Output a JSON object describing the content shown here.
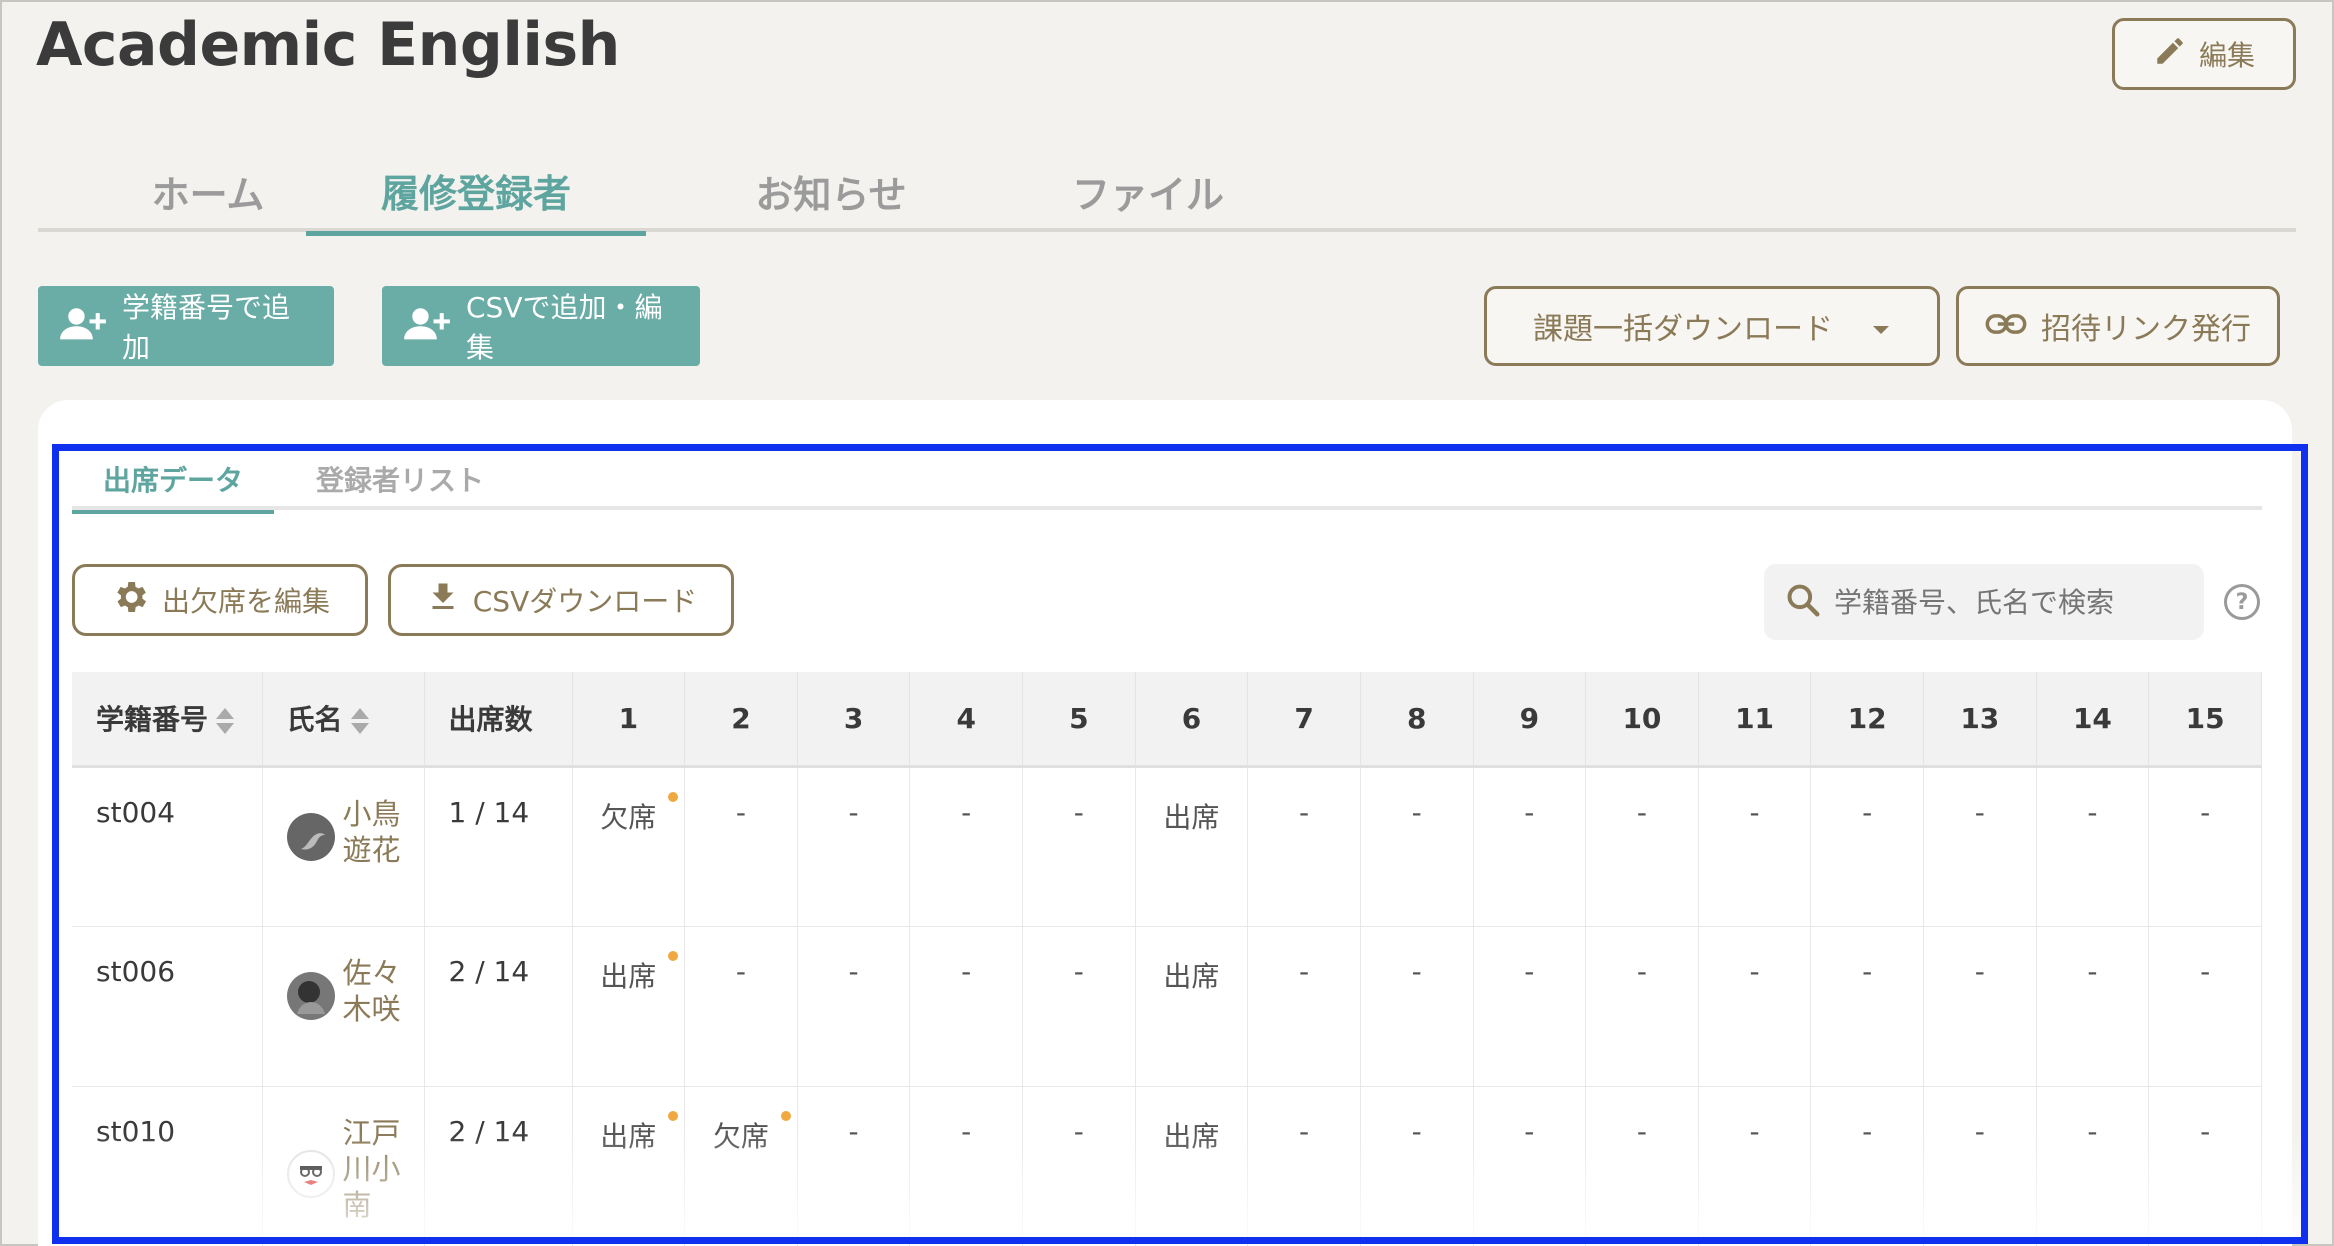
{
  "header": {
    "title": "Academic English",
    "edit_label": "編集"
  },
  "tabs": [
    {
      "label": "ホーム"
    },
    {
      "label": "履修登録者"
    },
    {
      "label": "お知らせ"
    },
    {
      "label": "ファイル"
    }
  ],
  "actions": {
    "add_by_id": "学籍番号で追加",
    "add_by_csv": "CSVで追加・編集",
    "bulk_download": "課題一括ダウンロード",
    "invite_link": "招待リンク発行"
  },
  "subtabs": [
    {
      "label": "出席データ"
    },
    {
      "label": "登録者リスト"
    }
  ],
  "tools": {
    "edit_attendance": "出欠席を編集",
    "csv_download": "CSVダウンロード",
    "search_placeholder": "学籍番号、氏名で検索",
    "help": "?"
  },
  "table": {
    "headers": [
      "学籍番号",
      "氏名",
      "出席数",
      "1",
      "2",
      "3",
      "4",
      "5",
      "6",
      "7",
      "8",
      "9",
      "10",
      "11",
      "12",
      "13",
      "14",
      "15"
    ],
    "rows": [
      {
        "id": "st004",
        "name": "小鳥遊花",
        "count": "1 / 14",
        "cells": [
          "欠席",
          "-",
          "-",
          "-",
          "-",
          "出席",
          "-",
          "-",
          "-",
          "-",
          "-",
          "-",
          "-",
          "-",
          "-"
        ]
      },
      {
        "id": "st006",
        "name": "佐々木咲",
        "count": "2 / 14",
        "cells": [
          "出席",
          "-",
          "-",
          "-",
          "-",
          "出席",
          "-",
          "-",
          "-",
          "-",
          "-",
          "-",
          "-",
          "-",
          "-"
        ]
      },
      {
        "id": "st010",
        "name": "江戸川小南",
        "count": "2 / 14",
        "cells": [
          "出席",
          "欠席",
          "-",
          "-",
          "-",
          "出席",
          "-",
          "-",
          "-",
          "-",
          "-",
          "-",
          "-",
          "-",
          "-"
        ]
      }
    ]
  },
  "colors": {
    "accent": "#5fa59f",
    "brand_brown": "#8a7a57",
    "absent": "#d9534f",
    "dot": "#f0a840",
    "highlight": "#1030f0"
  }
}
